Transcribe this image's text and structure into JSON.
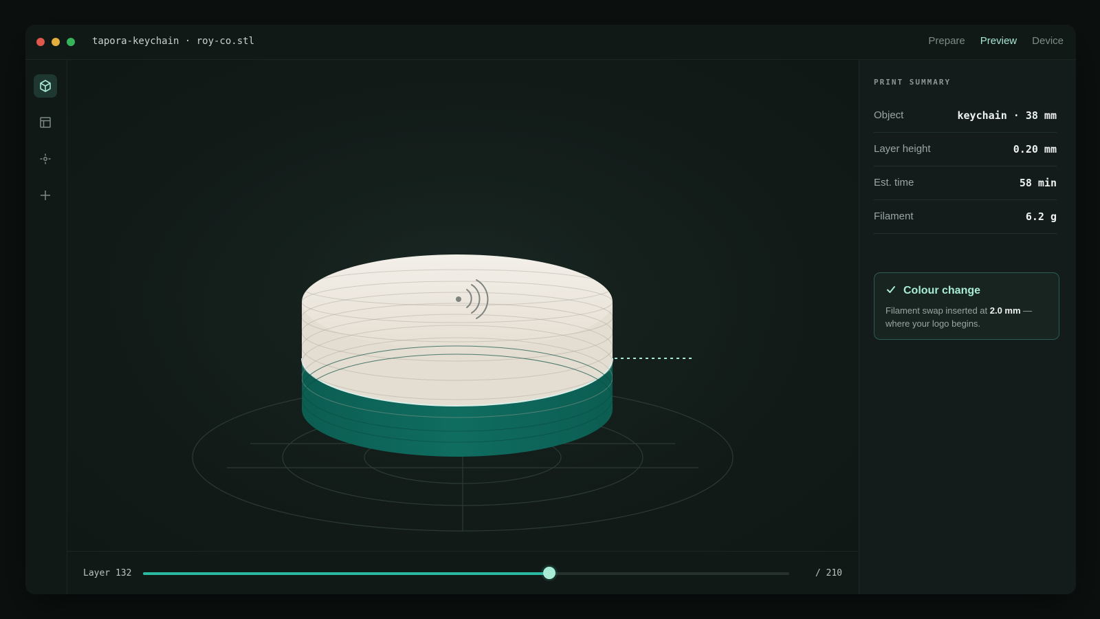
{
  "window": {
    "file_title": "tapora-keychain · roy-co.stl"
  },
  "nav": {
    "tabs": [
      {
        "label": "Prepare",
        "active": false
      },
      {
        "label": "Preview",
        "active": true
      },
      {
        "label": "Device",
        "active": false
      }
    ]
  },
  "sidebar": {
    "tools": [
      {
        "icon": "cube-icon",
        "active": true
      },
      {
        "icon": "layout-icon",
        "active": false
      },
      {
        "icon": "crosshair-icon",
        "active": false
      },
      {
        "icon": "plus-icon",
        "active": false
      }
    ]
  },
  "layer_slider": {
    "label": "Layer 132",
    "current": 132,
    "total_label": "/ 210",
    "total": 210
  },
  "summary": {
    "title": "PRINT SUMMARY",
    "rows": [
      {
        "key": "Object",
        "value": "keychain · 38 mm"
      },
      {
        "key": "Layer height",
        "value": "0.20 mm"
      },
      {
        "key": "Est. time",
        "value": "58 min"
      },
      {
        "key": "Filament",
        "value": "6.2 g"
      }
    ]
  },
  "notice": {
    "title": "Colour change",
    "body_prefix": "Filament swap inserted at ",
    "body_value": "2.0 mm",
    "body_suffix": " — where your logo begins."
  },
  "colors": {
    "accent": "#2bb9a0",
    "accent_light": "#a8ecd6",
    "base_filament": "#0e6b5f",
    "top_filament": "#efe9e0"
  }
}
